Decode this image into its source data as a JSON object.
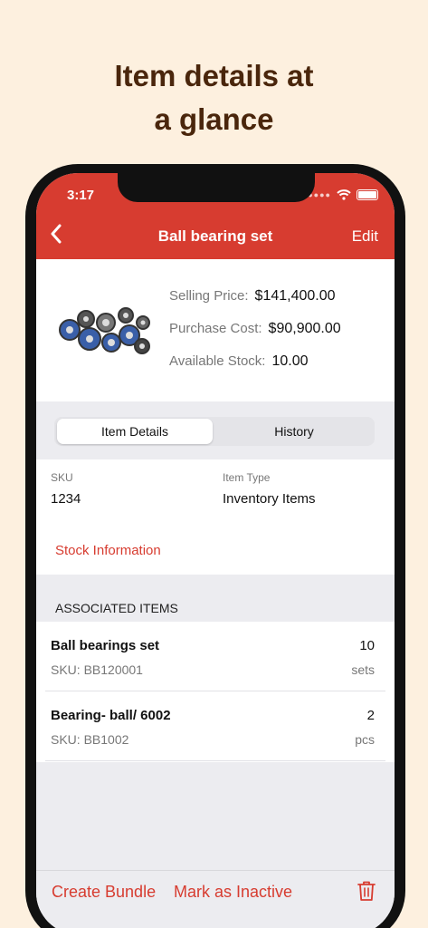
{
  "headline": {
    "line1": "Item details at",
    "line2": "a glance"
  },
  "status_bar": {
    "time": "3:17"
  },
  "nav": {
    "title": "Ball bearing set",
    "edit_label": "Edit",
    "back_icon": "chevron-left-icon"
  },
  "summary": {
    "selling_price_label": "Selling Price:",
    "selling_price_value": "$141,400.00",
    "purchase_cost_label": "Purchase Cost:",
    "purchase_cost_value": "$90,900.00",
    "available_stock_label": "Available Stock:",
    "available_stock_value": "10.00"
  },
  "tabs": {
    "item_details": "Item Details",
    "history": "History",
    "selected": "Item Details"
  },
  "details": {
    "sku_label": "SKU",
    "sku_value": "1234",
    "item_type_label": "Item Type",
    "item_type_value": "Inventory Items",
    "stock_link": "Stock Information"
  },
  "associated": {
    "header": "ASSOCIATED ITEMS",
    "items": [
      {
        "name": "Ball bearings set",
        "sku": "SKU: BB120001",
        "qty": "10",
        "unit": "sets"
      },
      {
        "name": "Bearing- ball/ 6002",
        "sku": "SKU: BB1002",
        "qty": "2",
        "unit": "pcs"
      }
    ]
  },
  "toolbar": {
    "create_bundle": "Create Bundle",
    "mark_inactive": "Mark as Inactive",
    "delete_icon": "trash-icon"
  },
  "colors": {
    "accent": "#d73c30",
    "background": "#fdf0df",
    "headline": "#4a260c"
  }
}
